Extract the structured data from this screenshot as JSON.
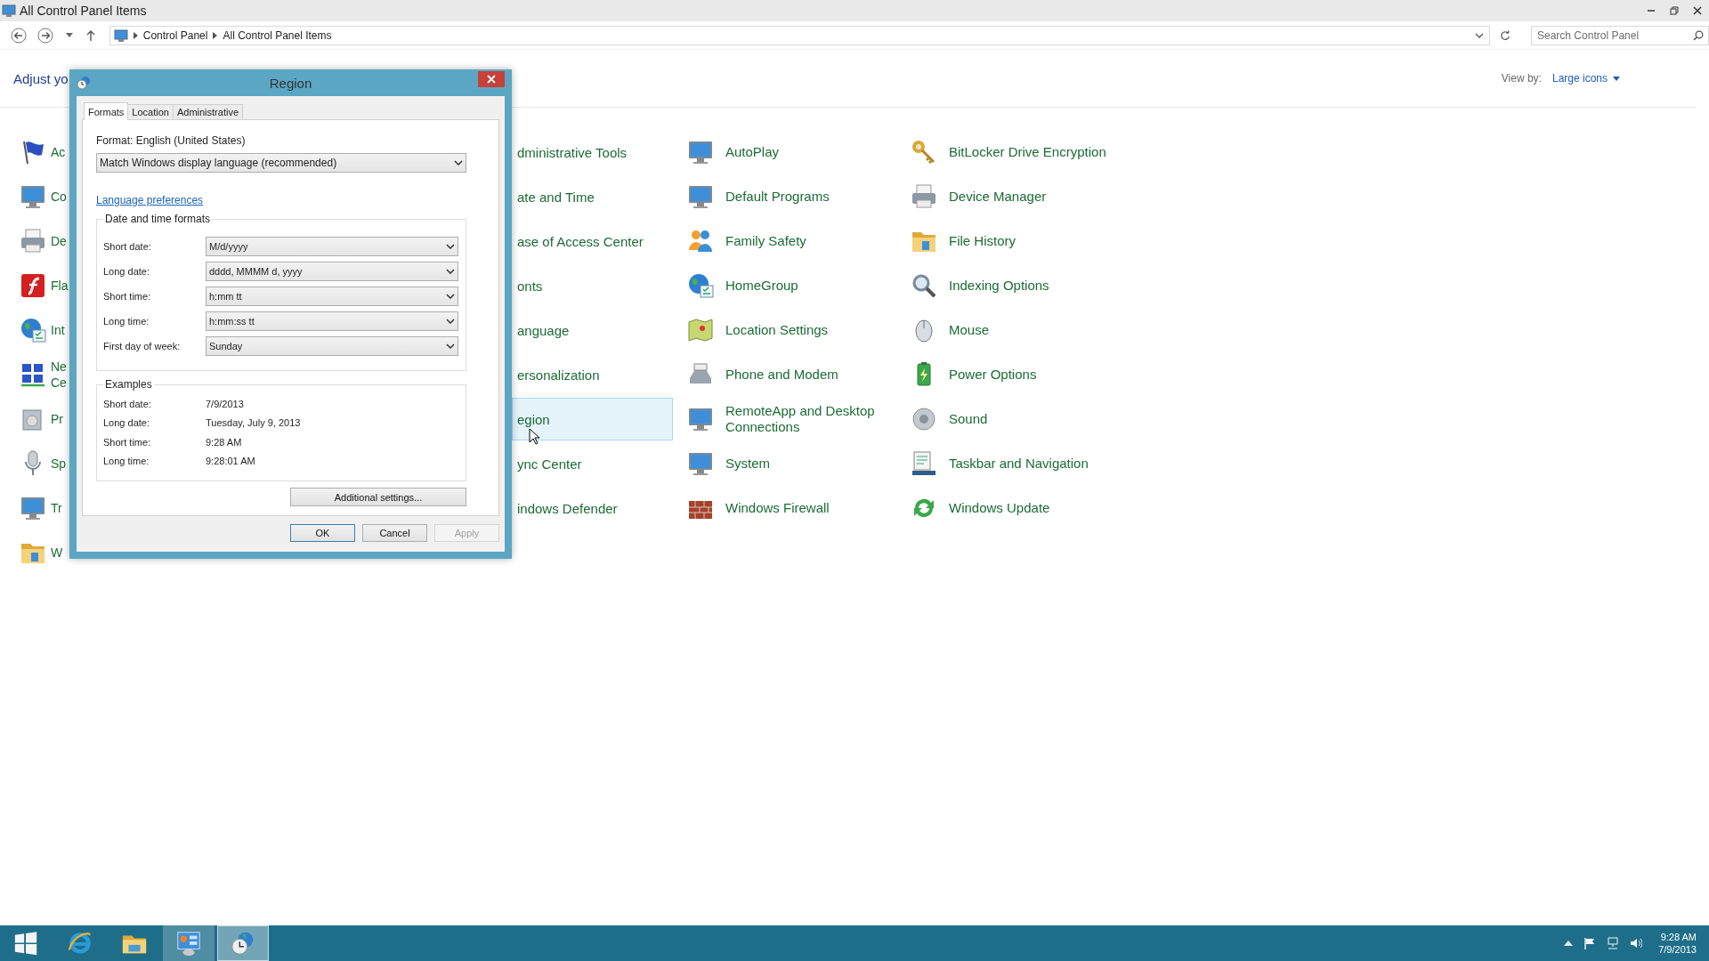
{
  "window": {
    "title": "All Control Panel Items"
  },
  "address_bar": {
    "breadcrumbs": [
      "Control Panel",
      "All Control Panel Items"
    ],
    "search": {
      "placeholder": "Search Control Panel"
    }
  },
  "header": {
    "title": "Adjust yo",
    "view_by_label": "View by:",
    "view_by_value": "Large icons"
  },
  "columns": [
    {
      "kind": "clipped",
      "items": [
        {
          "label": "Ac",
          "selected": false
        },
        {
          "label": "Co",
          "selected": false
        },
        {
          "label": "De",
          "selected": false
        },
        {
          "label": "Fla",
          "selected": false
        },
        {
          "label": "Int",
          "selected": false
        },
        {
          "label": "Ne Ce",
          "selected": false
        },
        {
          "label": "Pr",
          "selected": false
        },
        {
          "label": "Sp",
          "selected": false
        },
        {
          "label": "Tr",
          "selected": false
        },
        {
          "label": "W",
          "selected": false
        }
      ]
    },
    {
      "kind": "text_only",
      "items": [
        {
          "label": "dministrative Tools",
          "selected": false
        },
        {
          "label": "ate and Time",
          "selected": false
        },
        {
          "label": "ase of Access Center",
          "selected": false
        },
        {
          "label": "onts",
          "selected": false
        },
        {
          "label": "anguage",
          "selected": false
        },
        {
          "label": "ersonalization",
          "selected": false
        },
        {
          "label": "egion",
          "selected": true
        },
        {
          "label": "ync Center",
          "selected": false
        },
        {
          "label": "indows Defender",
          "selected": false
        }
      ]
    },
    {
      "kind": "icon",
      "items": [
        {
          "label": "AutoPlay",
          "selected": false
        },
        {
          "label": "Default Programs",
          "selected": false
        },
        {
          "label": "Family Safety",
          "selected": false
        },
        {
          "label": "HomeGroup",
          "selected": false
        },
        {
          "label": "Location Settings",
          "selected": false
        },
        {
          "label": "Phone and Modem",
          "selected": false
        },
        {
          "label": "RemoteApp and Desktop Connections",
          "selected": false
        },
        {
          "label": "System",
          "selected": false
        },
        {
          "label": "Windows Firewall",
          "selected": false
        }
      ]
    },
    {
      "kind": "icon",
      "items": [
        {
          "label": "BitLocker Drive Encryption",
          "selected": false
        },
        {
          "label": "Device Manager",
          "selected": false
        },
        {
          "label": "File History",
          "selected": false
        },
        {
          "label": "Indexing Options",
          "selected": false
        },
        {
          "label": "Mouse",
          "selected": false
        },
        {
          "label": "Power Options",
          "selected": false
        },
        {
          "label": "Sound",
          "selected": false
        },
        {
          "label": "Taskbar and Navigation",
          "selected": false
        },
        {
          "label": "Windows Update",
          "selected": false
        }
      ]
    }
  ],
  "dialog": {
    "title": "Region",
    "tabs": [
      {
        "label": "Formats",
        "selected": true
      },
      {
        "label": "Location",
        "selected": false
      },
      {
        "label": "Administrative",
        "selected": false
      }
    ],
    "format_label": "Format: English (United States)",
    "format_value": "Match Windows display language (recommended)",
    "link": "Language preferences",
    "formats_group": {
      "title": "Date and time formats",
      "rows": [
        {
          "label": "Short date:",
          "value": "M/d/yyyy"
        },
        {
          "label": "Long date:",
          "value": "dddd, MMMM d, yyyy"
        },
        {
          "label": "Short time:",
          "value": "h:mm tt"
        },
        {
          "label": "Long time:",
          "value": "h:mm:ss tt"
        },
        {
          "label": "First day of week:",
          "value": "Sunday"
        }
      ]
    },
    "examples_group": {
      "title": "Examples",
      "rows": [
        {
          "label": "Short date:",
          "value": "7/9/2013"
        },
        {
          "label": "Long date:",
          "value": "Tuesday, July 9, 2013"
        },
        {
          "label": "Short time:",
          "value": "9:28 AM"
        },
        {
          "label": "Long time:",
          "value": "9:28:01 AM"
        }
      ]
    },
    "additional_button": "Additional settings...",
    "buttons": [
      {
        "label": "OK",
        "default": true,
        "disabled": false
      },
      {
        "label": "Cancel",
        "default": false,
        "disabled": false
      },
      {
        "label": "Apply",
        "default": false,
        "disabled": true
      }
    ]
  },
  "taskbar": {
    "apps": [
      {
        "kind": "start",
        "running": false,
        "selected": false
      },
      {
        "kind": "browser",
        "running": false,
        "selected": false
      },
      {
        "kind": "folder",
        "running": false,
        "selected": false
      },
      {
        "kind": "panel",
        "running": true,
        "selected": false
      },
      {
        "kind": "clock",
        "running": true,
        "selected": true
      }
    ],
    "clock": {
      "time": "9:28 AM",
      "date": "7/9/2013"
    }
  }
}
